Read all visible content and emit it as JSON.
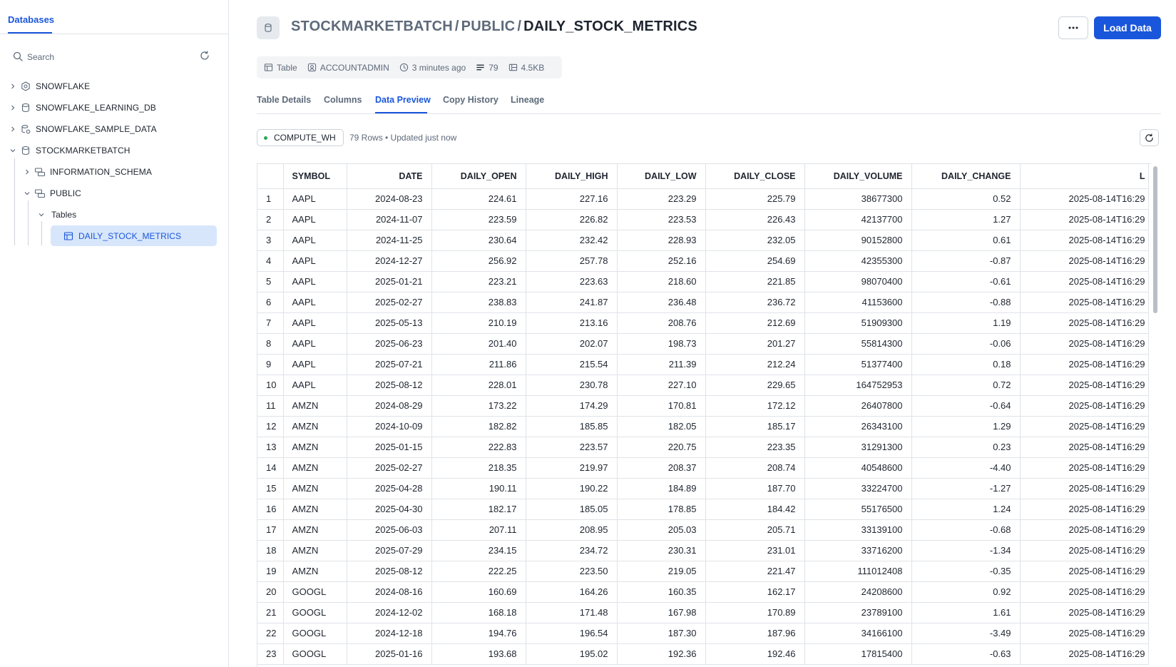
{
  "sidebar": {
    "tab_label": "Databases",
    "search_placeholder": "Search",
    "tree": {
      "db1": "SNOWFLAKE",
      "db2": "SNOWFLAKE_LEARNING_DB",
      "db3": "SNOWFLAKE_SAMPLE_DATA",
      "db4": "STOCKMARKETBATCH",
      "schema1": "INFORMATION_SCHEMA",
      "schema2": "PUBLIC",
      "folder": "Tables",
      "table": "DAILY_STOCK_METRICS"
    }
  },
  "header": {
    "breadcrumb": [
      "STOCKMARKETBATCH",
      "PUBLIC",
      "DAILY_STOCK_METRICS"
    ],
    "separator": "/",
    "load_button": "Load Data",
    "more_icon": "ellipsis-icon"
  },
  "meta": {
    "type": "Table",
    "owner": "ACCOUNTADMIN",
    "updated": "3 minutes ago",
    "rows": "79",
    "size": "4.5KB"
  },
  "tabs": [
    "Table Details",
    "Columns",
    "Data Preview",
    "Copy History",
    "Lineage"
  ],
  "active_tab": "Data Preview",
  "preview": {
    "warehouse": "COMPUTE_WH",
    "info": "79 Rows • Updated just now"
  },
  "table": {
    "columns": [
      "SYMBOL",
      "DATE",
      "DAILY_OPEN",
      "DAILY_HIGH",
      "DAILY_LOW",
      "DAILY_CLOSE",
      "DAILY_VOLUME",
      "DAILY_CHANGE",
      "L"
    ],
    "rows": [
      [
        "1",
        "AAPL",
        "2024-08-23",
        "224.61",
        "227.16",
        "223.29",
        "225.79",
        "38677300",
        "0.52",
        "2025-08-14T16:29"
      ],
      [
        "2",
        "AAPL",
        "2024-11-07",
        "223.59",
        "226.82",
        "223.53",
        "226.43",
        "42137700",
        "1.27",
        "2025-08-14T16:29"
      ],
      [
        "3",
        "AAPL",
        "2024-11-25",
        "230.64",
        "232.42",
        "228.93",
        "232.05",
        "90152800",
        "0.61",
        "2025-08-14T16:29"
      ],
      [
        "4",
        "AAPL",
        "2024-12-27",
        "256.92",
        "257.78",
        "252.16",
        "254.69",
        "42355300",
        "-0.87",
        "2025-08-14T16:29"
      ],
      [
        "5",
        "AAPL",
        "2025-01-21",
        "223.21",
        "223.63",
        "218.60",
        "221.85",
        "98070400",
        "-0.61",
        "2025-08-14T16:29"
      ],
      [
        "6",
        "AAPL",
        "2025-02-27",
        "238.83",
        "241.87",
        "236.48",
        "236.72",
        "41153600",
        "-0.88",
        "2025-08-14T16:29"
      ],
      [
        "7",
        "AAPL",
        "2025-05-13",
        "210.19",
        "213.16",
        "208.76",
        "212.69",
        "51909300",
        "1.19",
        "2025-08-14T16:29"
      ],
      [
        "8",
        "AAPL",
        "2025-06-23",
        "201.40",
        "202.07",
        "198.73",
        "201.27",
        "55814300",
        "-0.06",
        "2025-08-14T16:29"
      ],
      [
        "9",
        "AAPL",
        "2025-07-21",
        "211.86",
        "215.54",
        "211.39",
        "212.24",
        "51377400",
        "0.18",
        "2025-08-14T16:29"
      ],
      [
        "10",
        "AAPL",
        "2025-08-12",
        "228.01",
        "230.78",
        "227.10",
        "229.65",
        "164752953",
        "0.72",
        "2025-08-14T16:29"
      ],
      [
        "11",
        "AMZN",
        "2024-08-29",
        "173.22",
        "174.29",
        "170.81",
        "172.12",
        "26407800",
        "-0.64",
        "2025-08-14T16:29"
      ],
      [
        "12",
        "AMZN",
        "2024-10-09",
        "182.82",
        "185.85",
        "182.05",
        "185.17",
        "26343100",
        "1.29",
        "2025-08-14T16:29"
      ],
      [
        "13",
        "AMZN",
        "2025-01-15",
        "222.83",
        "223.57",
        "220.75",
        "223.35",
        "31291300",
        "0.23",
        "2025-08-14T16:29"
      ],
      [
        "14",
        "AMZN",
        "2025-02-27",
        "218.35",
        "219.97",
        "208.37",
        "208.74",
        "40548600",
        "-4.40",
        "2025-08-14T16:29"
      ],
      [
        "15",
        "AMZN",
        "2025-04-28",
        "190.11",
        "190.22",
        "184.89",
        "187.70",
        "33224700",
        "-1.27",
        "2025-08-14T16:29"
      ],
      [
        "16",
        "AMZN",
        "2025-04-30",
        "182.17",
        "185.05",
        "178.85",
        "184.42",
        "55176500",
        "1.24",
        "2025-08-14T16:29"
      ],
      [
        "17",
        "AMZN",
        "2025-06-03",
        "207.11",
        "208.95",
        "205.03",
        "205.71",
        "33139100",
        "-0.68",
        "2025-08-14T16:29"
      ],
      [
        "18",
        "AMZN",
        "2025-07-29",
        "234.15",
        "234.72",
        "230.31",
        "231.01",
        "33716200",
        "-1.34",
        "2025-08-14T16:29"
      ],
      [
        "19",
        "AMZN",
        "2025-08-12",
        "222.25",
        "223.50",
        "219.05",
        "221.47",
        "111012408",
        "-0.35",
        "2025-08-14T16:29"
      ],
      [
        "20",
        "GOOGL",
        "2024-08-16",
        "160.69",
        "164.26",
        "160.35",
        "162.17",
        "24208600",
        "0.92",
        "2025-08-14T16:29"
      ],
      [
        "21",
        "GOOGL",
        "2024-12-02",
        "168.18",
        "171.48",
        "167.98",
        "170.89",
        "23789100",
        "1.61",
        "2025-08-14T16:29"
      ],
      [
        "22",
        "GOOGL",
        "2024-12-18",
        "194.76",
        "196.54",
        "187.30",
        "187.96",
        "34166100",
        "-3.49",
        "2025-08-14T16:29"
      ],
      [
        "23",
        "GOOGL",
        "2025-01-16",
        "193.68",
        "195.02",
        "192.36",
        "192.46",
        "17815400",
        "-0.63",
        "2025-08-14T16:29"
      ]
    ]
  },
  "colors": {
    "accent": "#1a56db",
    "selected_bg": "#d7e6fb",
    "status_green": "#2aa55b"
  }
}
